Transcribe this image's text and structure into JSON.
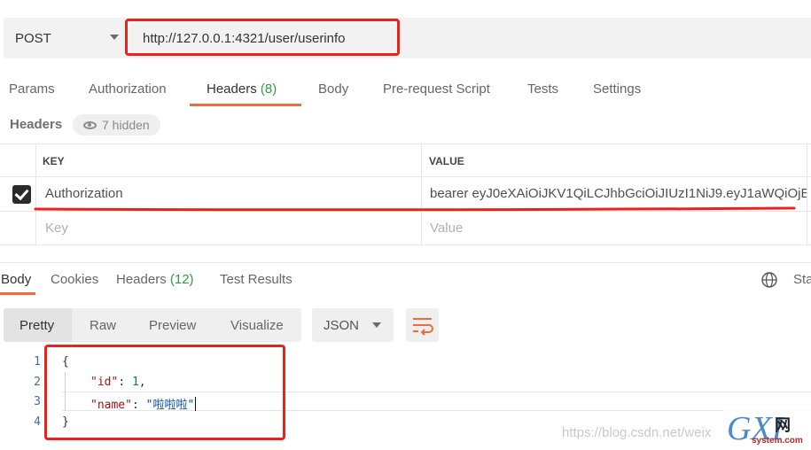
{
  "request": {
    "method": "POST",
    "url": "http://127.0.0.1:4321/user/userinfo"
  },
  "request_tabs": [
    {
      "label": "Params"
    },
    {
      "label": "Authorization"
    },
    {
      "label": "Headers",
      "count": "(8)"
    },
    {
      "label": "Body"
    },
    {
      "label": "Pre-request Script"
    },
    {
      "label": "Tests"
    },
    {
      "label": "Settings"
    }
  ],
  "headers_section": {
    "title": "Headers",
    "hidden_label": "7 hidden",
    "columns": {
      "key": "KEY",
      "value": "VALUE"
    },
    "rows": [
      {
        "checked": true,
        "key": "Authorization",
        "value": "bearer eyJ0eXAiOiJKV1QiLCJhbGciOiJIUzI1NiJ9.eyJ1aWQiOjE..."
      }
    ],
    "new_row": {
      "key_placeholder": "Key",
      "value_placeholder": "Value"
    }
  },
  "response_tabs": [
    {
      "label": "Body"
    },
    {
      "label": "Cookies"
    },
    {
      "label": "Headers",
      "count": "(12)"
    },
    {
      "label": "Test Results"
    }
  ],
  "status_partial": "Sta",
  "format_toolbar": {
    "modes": [
      "Pretty",
      "Raw",
      "Preview",
      "Visualize"
    ],
    "language": "JSON"
  },
  "code_lines": {
    "numbers": [
      "1",
      "2",
      "3",
      "4"
    ],
    "open_brace": "{",
    "id_key": "\"id\"",
    "id_sep": ": ",
    "id_value": "1",
    "id_comma": ",",
    "name_key": "\"name\"",
    "name_sep": ": ",
    "name_value": "\"啦啦啦\"",
    "close_brace": "}"
  },
  "watermark": "https://blog.csdn.net/weix",
  "logo": {
    "main": "GXI",
    "net": "网",
    "sub": "system.com"
  },
  "colors": {
    "accent": "#f26b3a",
    "count_green": "#2e9a47",
    "highlight_red": "#e8231a"
  }
}
